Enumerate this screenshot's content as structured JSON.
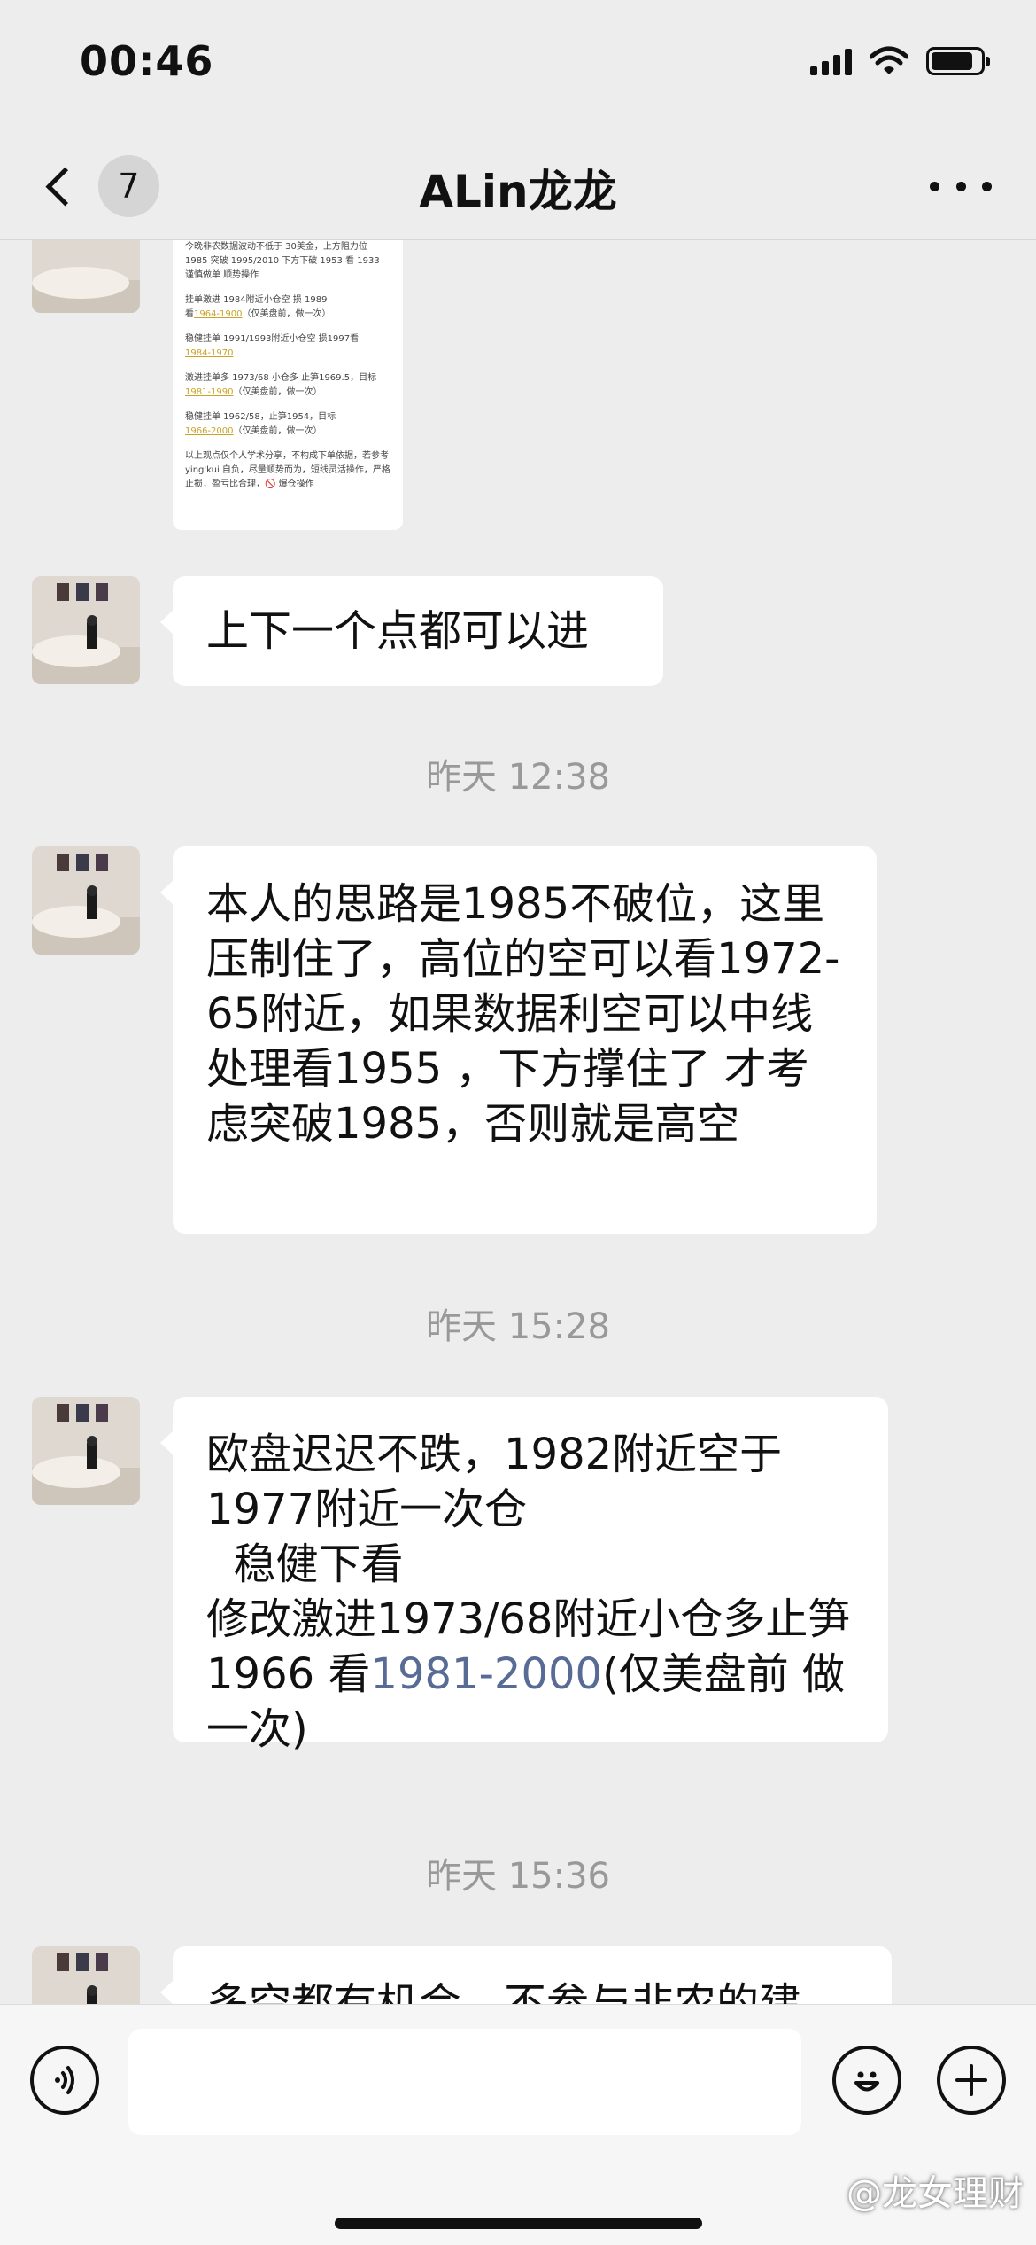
{
  "status_bar": {
    "time": "00:46"
  },
  "nav": {
    "unread_count": "7",
    "title": "ALin龙龙"
  },
  "image_message": {
    "lines": [
      "今晚非农数据波动不低于 30美金，上方阻力位 1985 突破 1995/2010 下方下破 1953 看 1933 谨慎做单 顺势操作",
      "挂单激进 1984附近小仓空 损 1989",
      "看",
      "1964-1900",
      "（仅美盘前，做一次）",
      "稳健挂单 1991/1993附近小仓空 损1997看",
      "1984-1970",
      "激进挂单多 1973/68 小仓多 止笋1969.5，目标",
      "1981-1990",
      "（仅美盘前，做一次）",
      "稳健挂单 1962/58，止笋1954，目标",
      "1966-2000",
      "（仅美盘前，做一次）",
      "以上观点仅个人学术分享，不构成下单依据，若参考 ying'kui 自负，尽量顺势而为，短线灵活操作，严格止损，盈亏比合理，🚫 爆仓操作"
    ]
  },
  "messages": [
    {
      "text": "上下一个点都可以进"
    },
    {
      "timestamp": "昨天 12:38"
    },
    {
      "text": "本人的思路是1985不破位，这里压制住了，高位的空可以看1972-65附近，如果数据利空可以中线处理看1955 ，下方撑住了 才考虑突破1985，否则就是高空"
    },
    {
      "timestamp": "昨天 15:28"
    },
    {
      "text_line1": "欧盘迟迟不跌，1982附近空于1977附近一次仓",
      "text_line2": "  稳健下看",
      "text_line3": "修改激进1973/68附近小仓多止笋1966  看",
      "link": "1981-2000",
      "text_line4": "(仅美盘前 做一次)"
    },
    {
      "timestamp": "昨天 15:36"
    },
    {
      "text": "多空都有机会，不参与非农的建"
    }
  ],
  "input_bar": {
    "placeholder": ""
  },
  "watermark": "@龙女理财"
}
